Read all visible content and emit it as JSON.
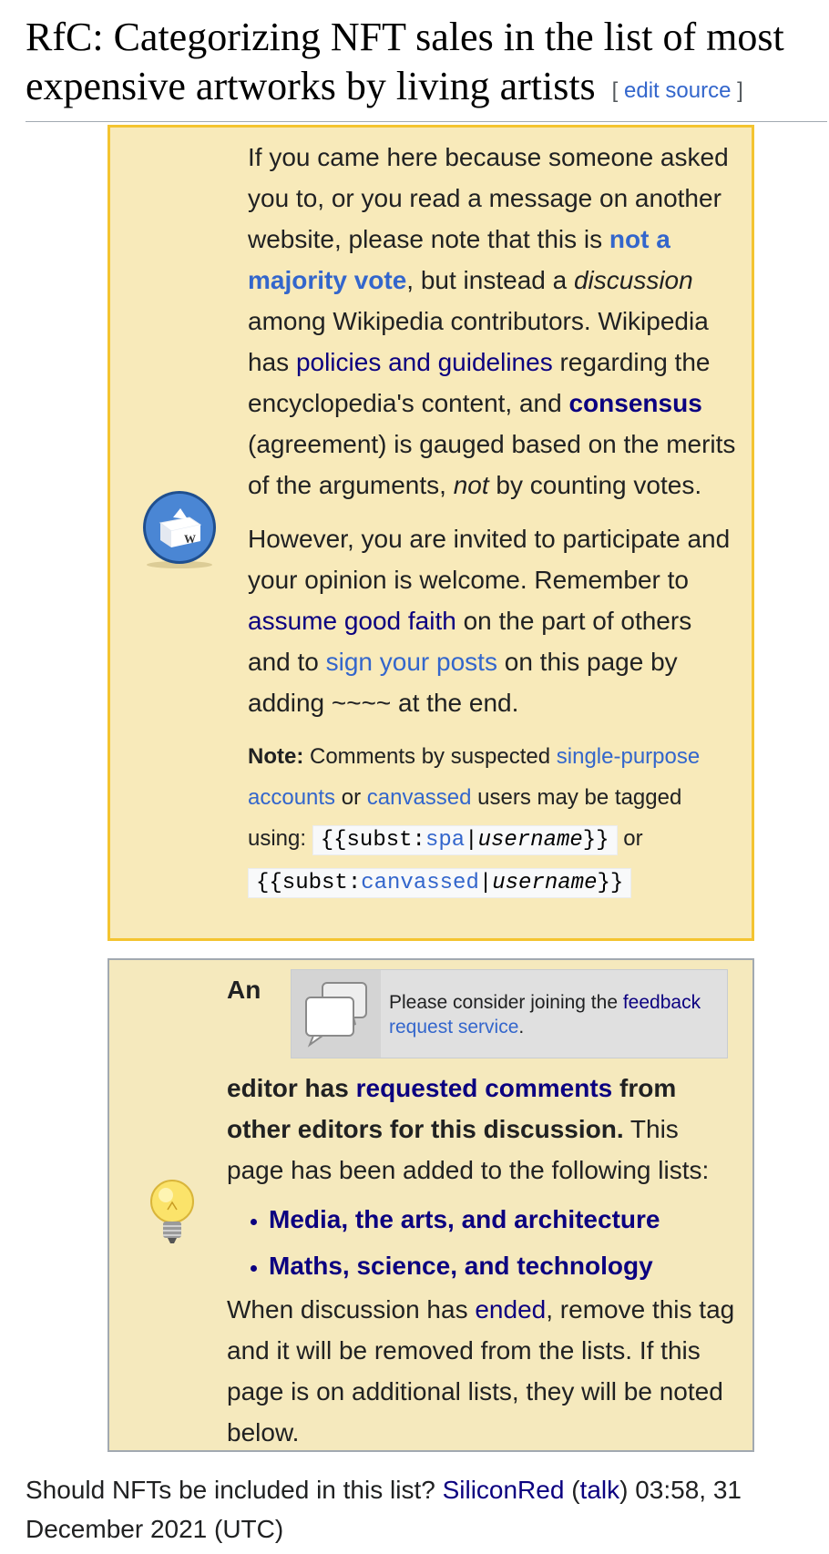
{
  "heading": {
    "title": "RfC: Categorizing NFT sales in the list of most expensive artworks by living artists",
    "edit_bracket_open": "[",
    "edit_label": "edit source",
    "edit_bracket_close": "]"
  },
  "notice": {
    "p1_part1": "If you came here because someone asked you to, or you read a message on another website, please note that this is ",
    "p1_link_majority": "not a majority vote",
    "p1_part2": ", but instead a ",
    "p1_discussion": "discussion",
    "p1_part3": " among Wikipedia contributors. Wikipedia has ",
    "p1_link_policies": "policies and guidelines",
    "p1_part4": " regarding the encyclopedia's content, and ",
    "p1_link_consensus": "consensus",
    "p1_part5": " (agreement) is gauged based on the merits of the arguments, ",
    "p1_not": "not",
    "p1_part6": " by counting votes.",
    "p2_part1": "However, you are invited to participate and your opinion is welcome. Remember to ",
    "p2_link_agf": "assume good faith",
    "p2_part2": " on the part of others and to ",
    "p2_link_sign": "sign your posts",
    "p2_part3": " on this page by adding ~~~~ at the end.",
    "note_label": "Note:",
    "note_part1": " Comments by suspected ",
    "note_link_spa": "single-purpose accounts",
    "note_part2": " or ",
    "note_link_canvassed": "canvassed",
    "note_part3": " users may be tagged using: ",
    "code1_a": "{{subst:",
    "code1_link": "spa",
    "code1_b": "|",
    "code1_italic": "username",
    "code1_c": "}}",
    "note_or": " or ",
    "code2_a": "{{subst:",
    "code2_link": "canvassed",
    "code2_b": "|",
    "code2_italic": "username",
    "code2_c": "}}",
    "icon": "ballot-box-icon"
  },
  "rfc": {
    "intro_an": "An",
    "feedback_text1": "Please consider joining the ",
    "feedback_link": "feedback request service",
    "feedback_text2": ".",
    "bold_part1": "editor has ",
    "link_requested": "requested comments",
    "bold_part2": " from other editors for this discussion.",
    "text_part1": " This page has been added to the following lists:",
    "lists": [
      "Media, the arts, and architecture",
      "Maths, science, and technology"
    ],
    "end_part1": "When discussion has ",
    "end_link": "ended",
    "end_part2": ", remove this tag and it will be removed from the lists. If this page is on additional lists, they will be noted below.",
    "icon": "lightbulb-icon",
    "feedback_icon": "speech-bubbles-icon"
  },
  "footer": {
    "question": "Should NFTs be included in this list? ",
    "user_link": "SiliconRed",
    "paren_open": " (",
    "talk_link": "talk",
    "paren_close": ")",
    "timestamp": " 03:58, 31 December 2021 (UTC)"
  }
}
